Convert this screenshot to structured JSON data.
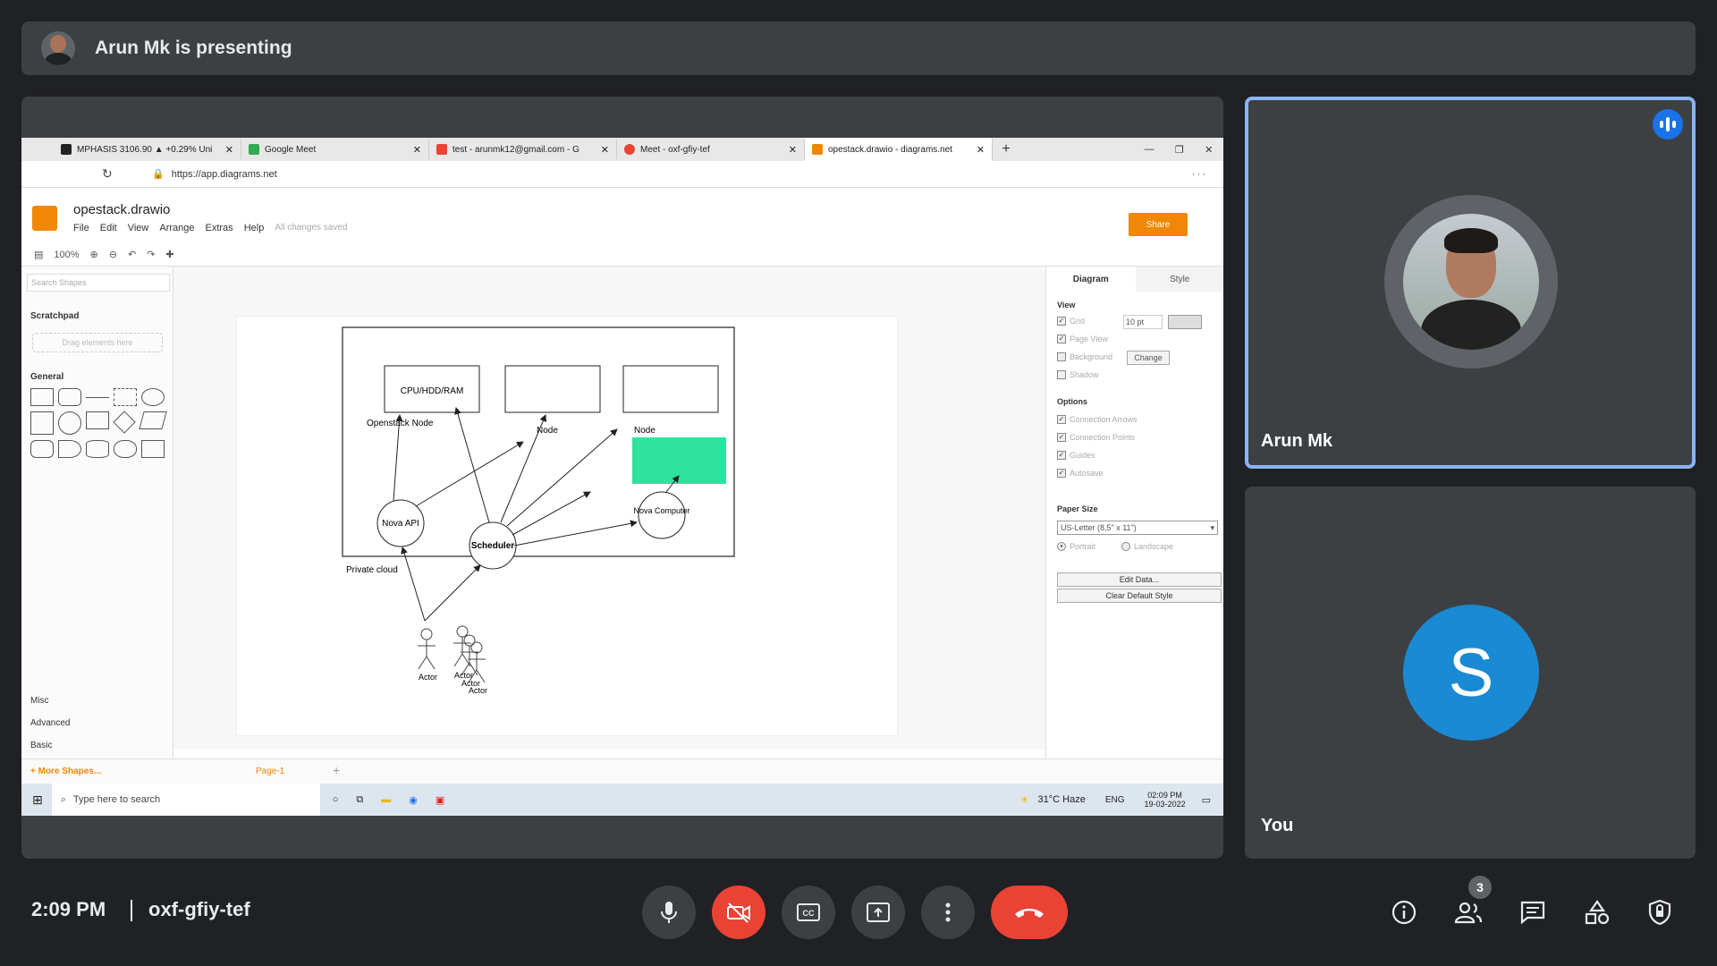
{
  "presenting_banner": {
    "text": "Arun Mk is presenting"
  },
  "shared_screen": {
    "browser_tabs": [
      {
        "title": "MPHASIS 3106.90 ▲ +0.29% Uni",
        "color": "#222222"
      },
      {
        "title": "Google Meet",
        "color": "#34a853"
      },
      {
        "title": "test - arunmk12@gmail.com - G",
        "color": "#ea4335"
      },
      {
        "title": "Meet - oxf-gfiy-tef",
        "color": "#ea4335"
      },
      {
        "title": "opestack.drawio - diagrams.net",
        "color": "#f08705"
      }
    ],
    "url": "https://app.diagrams.net",
    "drawio": {
      "filename": "opestack.drawio",
      "menus": [
        "File",
        "Edit",
        "View",
        "Arrange",
        "Extras",
        "Help"
      ],
      "saved_status": "All changes saved",
      "share_label": "Share",
      "zoom": "100%",
      "search_shapes_placeholder": "Search Shapes",
      "scratchpad": "Scratchpad",
      "drag_here": "Drag elements here",
      "general": "General",
      "misc": "Misc",
      "advanced": "Advanced",
      "basic": "Basic",
      "more_shapes": "+ More Shapes...",
      "page_tab": "Page-1",
      "panel": {
        "tab_diagram": "Diagram",
        "tab_style": "Style",
        "view": "View",
        "grid": "Grid",
        "grid_size": "10 pt",
        "page_view": "Page View",
        "background": "Background",
        "change_btn": "Change",
        "shadow": "Shadow",
        "options": "Options",
        "connection_arrows": "Connection Arrows",
        "connection_points": "Connection Points",
        "guides": "Guides",
        "autosave": "Autosave",
        "paper_size": "Paper Size",
        "paper_value": "US-Letter (8,5\" x 11\")",
        "portrait": "Portrait",
        "landscape": "Landscape",
        "edit_data": "Edit Data...",
        "clear_style": "Clear Default Style"
      },
      "diagram_labels": {
        "cpu": "CPU/HDD/RAM",
        "openstack_node": "Openstack Node",
        "node1": "Node",
        "node2": "Node",
        "nova_api": "Nova API",
        "scheduler": "Scheduler",
        "nova_computer": "Nova Computer",
        "private_cloud": "Private cloud",
        "actor1": "Actor",
        "actor2": "Actor",
        "actor3": "Actor",
        "actor4": "Actor"
      }
    },
    "taskbar": {
      "search_placeholder": "Type here to search",
      "weather": "31°C  Haze",
      "lang": "ENG",
      "clock_time": "02:09 PM",
      "clock_date": "19-03-2022"
    }
  },
  "participants": [
    {
      "name": "Arun Mk",
      "speaking": true
    },
    {
      "name": "You",
      "initial": "S",
      "avatar_color": "#1a8ad4"
    }
  ],
  "meeting": {
    "time": "2:09 PM",
    "code": "oxf-gfiy-tef",
    "participant_count": "3"
  },
  "icons": [
    "mic-icon",
    "camera-off-icon",
    "captions-icon",
    "present-icon",
    "more-icon",
    "hangup-icon",
    "info-icon",
    "people-icon",
    "chat-icon",
    "activities-icon",
    "host-controls-icon"
  ]
}
